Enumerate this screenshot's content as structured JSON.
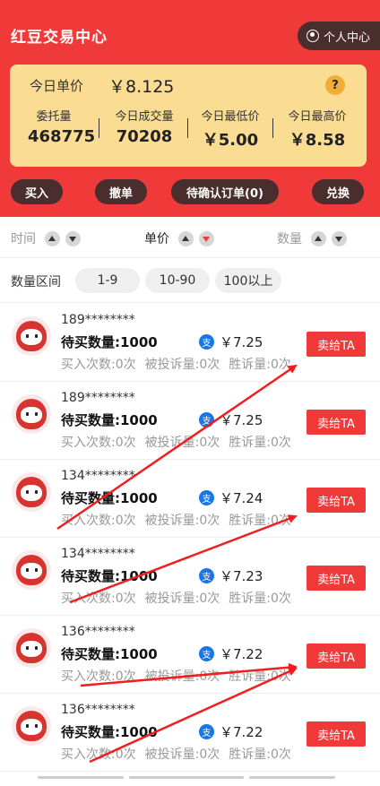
{
  "header": {
    "title": "红豆交易中心",
    "profile_label": "个人中心"
  },
  "summary": {
    "price_label": "今日单价",
    "price_value": "￥8.125",
    "help": "?",
    "stats": [
      {
        "label": "委托量",
        "value": "468775"
      },
      {
        "label": "今日成交量",
        "value": "70208"
      },
      {
        "label": "今日最低价",
        "value": "￥5.00"
      },
      {
        "label": "今日最高价",
        "value": "￥8.58"
      }
    ]
  },
  "actions": {
    "buy": "买入",
    "cancel": "撤单",
    "pending": "待确认订单(0)",
    "exchange": "兑换"
  },
  "sort": {
    "time": "时间",
    "price": "单价",
    "qty": "数量"
  },
  "range": {
    "label": "数量区间",
    "chips": [
      "1-9",
      "10-90",
      "100以上"
    ]
  },
  "rows": [
    {
      "phone": "189********",
      "want": "待买数量:1000",
      "pay": "支",
      "price": "￥7.25",
      "buys": "买入次数:0次",
      "complaints": "被投诉量:0次",
      "wins": "胜诉量:0次",
      "sell": "卖给TA"
    },
    {
      "phone": "189********",
      "want": "待买数量:1000",
      "pay": "支",
      "price": "￥7.25",
      "buys": "买入次数:0次",
      "complaints": "被投诉量:0次",
      "wins": "胜诉量:0次",
      "sell": "卖给TA"
    },
    {
      "phone": "134********",
      "want": "待买数量:1000",
      "pay": "支",
      "price": "￥7.24",
      "buys": "买入次数:0次",
      "complaints": "被投诉量:0次",
      "wins": "胜诉量:0次",
      "sell": "卖给TA"
    },
    {
      "phone": "134********",
      "want": "待买数量:1000",
      "pay": "支",
      "price": "￥7.23",
      "buys": "买入次数:0次",
      "complaints": "被投诉量:0次",
      "wins": "胜诉量:0次",
      "sell": "卖给TA"
    },
    {
      "phone": "136********",
      "want": "待买数量:1000",
      "pay": "支",
      "price": "￥7.22",
      "buys": "买入次数:0次",
      "complaints": "被投诉量:0次",
      "wins": "胜诉量:0次",
      "sell": "卖给TA"
    },
    {
      "phone": "136********",
      "want": "待买数量:1000",
      "pay": "支",
      "price": "￥7.22",
      "buys": "买入次数:0次",
      "complaints": "被投诉量:0次",
      "wins": "胜诉量:0次",
      "sell": "卖给TA"
    }
  ],
  "colors": {
    "brand_red": "#f03a3a",
    "dark_button": "#4a2d2d",
    "card_yellow": "#fbdc93",
    "alipay_blue": "#1976e6"
  },
  "sort_state": {
    "price": "descending"
  }
}
